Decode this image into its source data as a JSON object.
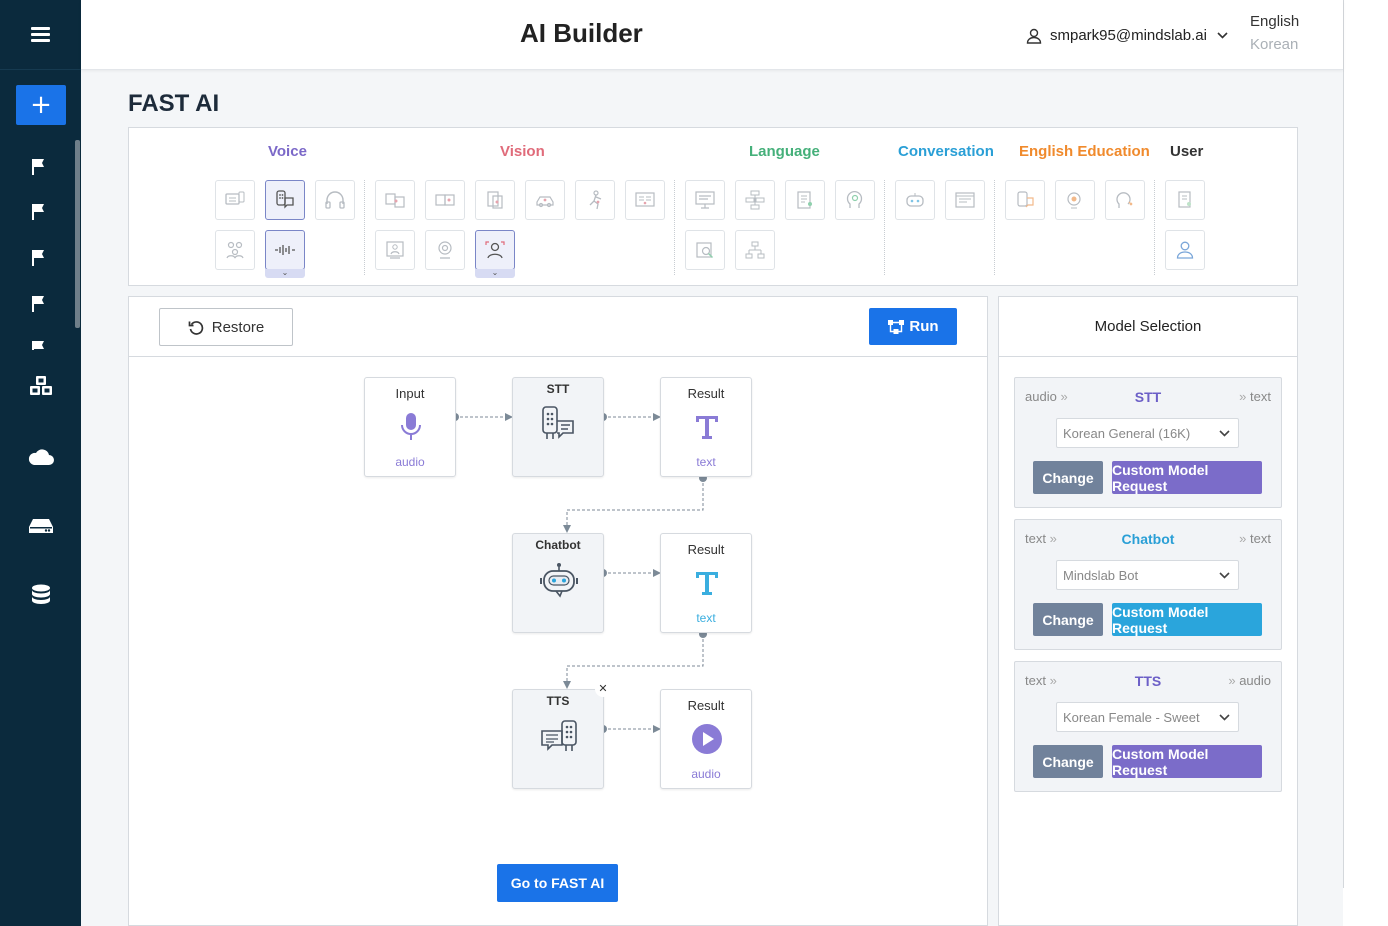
{
  "app": {
    "title": "AI Builder"
  },
  "user": {
    "email": "smpark95@mindslab.ai"
  },
  "languages": {
    "english": "English",
    "korean": "Korean"
  },
  "page": {
    "title": "FAST AI"
  },
  "categories": [
    {
      "label": "Voice",
      "color": "#7b68c8"
    },
    {
      "label": "Vision",
      "color": "#e06b7a"
    },
    {
      "label": "Language",
      "color": "#45b07a"
    },
    {
      "label": "Conversation",
      "color": "#2a9fd6"
    },
    {
      "label": "English Education",
      "color": "#f08a2c"
    },
    {
      "label": "User",
      "color": "#333333"
    }
  ],
  "toolbar": {
    "restore_label": "Restore",
    "run_label": "Run"
  },
  "flow": {
    "nodes": {
      "input": {
        "label": "Input",
        "sub": "audio"
      },
      "stt": {
        "label": "STT"
      },
      "result1": {
        "label": "Result",
        "sub": "text"
      },
      "chatbot": {
        "label": "Chatbot"
      },
      "result2": {
        "label": "Result",
        "sub": "text"
      },
      "tts": {
        "label": "TTS"
      },
      "result3": {
        "label": "Result",
        "sub": "audio"
      }
    },
    "goto_label": "Go to FAST AI"
  },
  "model_selection": {
    "title": "Model Selection",
    "cards": [
      {
        "input": "audio",
        "name": "STT",
        "output": "text",
        "selected": "Korean General (16K)",
        "change_label": "Change",
        "custom_label": "Custom Model Request",
        "name_color": "#6c5fc7",
        "custom_color": "#7b6cc9"
      },
      {
        "input": "text",
        "name": "Chatbot",
        "output": "text",
        "selected": "Mindslab Bot",
        "change_label": "Change",
        "custom_label": "Custom Model Request",
        "name_color": "#2a9fd6",
        "custom_color": "#2aa5dc"
      },
      {
        "input": "text",
        "name": "TTS",
        "output": "audio",
        "selected": "Korean Female - Sweet",
        "change_label": "Change",
        "custom_label": "Custom Model Request",
        "name_color": "#6c5fc7",
        "custom_color": "#7b6cc9"
      }
    ]
  }
}
